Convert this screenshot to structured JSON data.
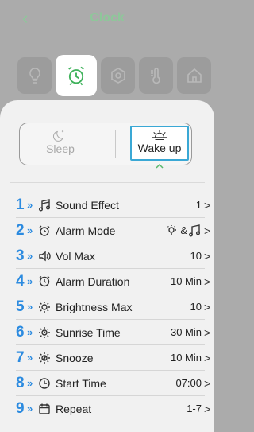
{
  "header": {
    "back_icon": "chevron-left-icon",
    "title": "Clock"
  },
  "modes": [
    {
      "icon": "bulb-icon",
      "active": false
    },
    {
      "icon": "alarm-clock-icon",
      "active": true
    },
    {
      "icon": "hexagon-icon",
      "active": false
    },
    {
      "icon": "thermometer-icon",
      "active": false
    },
    {
      "icon": "home-icon",
      "active": false
    }
  ],
  "segment": {
    "sleep_label": "Sleep",
    "wake_label": "Wake up"
  },
  "settings": [
    {
      "num": "1",
      "label": "Sound Effect",
      "value": "1",
      "icon": "music-note-icon"
    },
    {
      "num": "2",
      "label": "Alarm Mode",
      "value": "& ",
      "icon": "alarm-bell-icon"
    },
    {
      "num": "3",
      "label": "Vol Max",
      "value": "10",
      "icon": "speaker-icon"
    },
    {
      "num": "4",
      "label": "Alarm Duration",
      "value": "10 Min",
      "icon": "clock-duration-icon"
    },
    {
      "num": "5",
      "label": "Brightness Max",
      "value": "10",
      "icon": "brightness-icon"
    },
    {
      "num": "6",
      "label": "Sunrise Time",
      "value": "30 Min",
      "icon": "sunrise-icon"
    },
    {
      "num": "7",
      "label": "Snooze",
      "value": "10 Min",
      "icon": "snooze-icon"
    },
    {
      "num": "8",
      "label": "Start Time",
      "value": "07:00",
      "icon": "clock-icon"
    },
    {
      "num": "9",
      "label": "Repeat",
      "value": "1-7",
      "icon": "calendar-icon"
    }
  ],
  "colors": {
    "accent_green": "#3fb25b",
    "accent_blue": "#2c8be0",
    "highlight": "#3aa8d5"
  }
}
